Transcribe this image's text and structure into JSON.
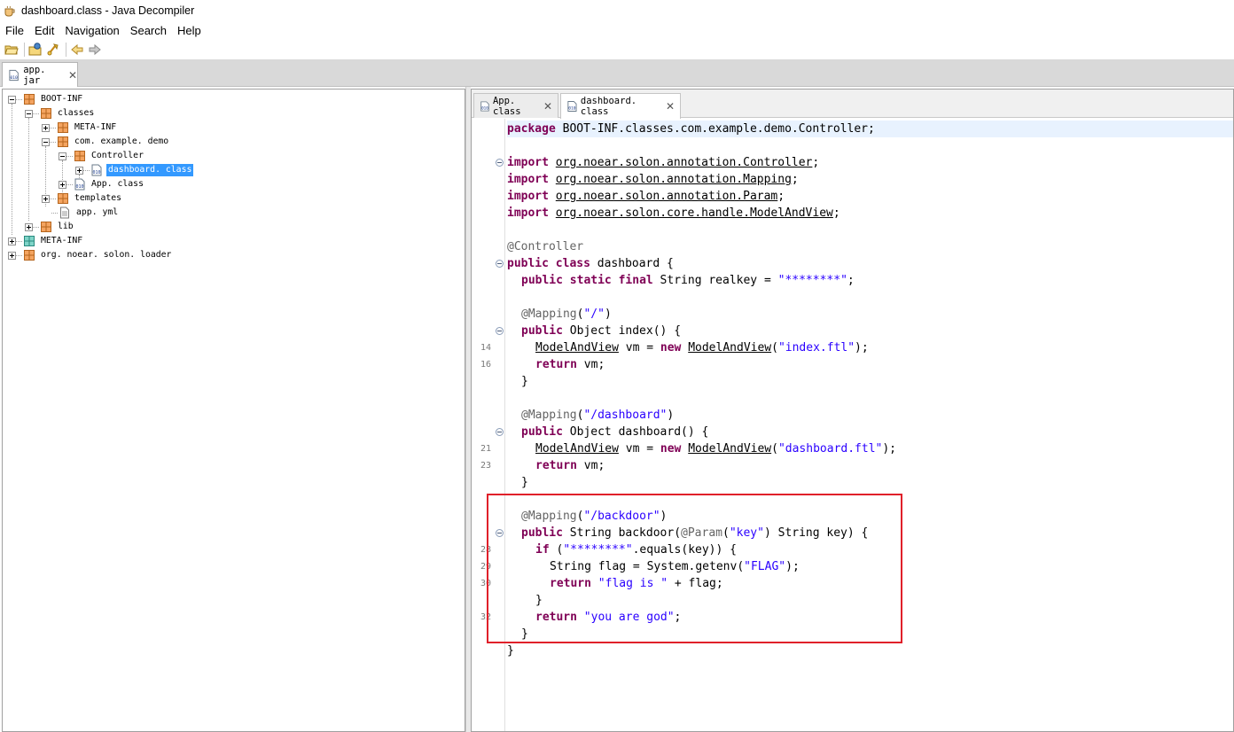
{
  "window": {
    "title": "dashboard.class - Java Decompiler"
  },
  "menu": [
    "File",
    "Edit",
    "Navigation",
    "Search",
    "Help"
  ],
  "toolbar": [
    "open-icon",
    "open-type-icon",
    "search-type-icon",
    "back-icon",
    "forward-icon"
  ],
  "jar_tab": {
    "label": "app. jar"
  },
  "tree": {
    "boot_inf": "BOOT-INF",
    "classes": "classes",
    "meta_inf_inner": "META-INF",
    "com_example_demo": "com. example. demo",
    "controller": "Controller",
    "dashboard_class": "dashboard. class",
    "app_class": "App. class",
    "templates": "templates",
    "app_yml": "app. yml",
    "lib": "lib",
    "meta_inf": "META-INF",
    "solon_loader": "org. noear. solon. loader"
  },
  "editor_tabs": [
    {
      "label": "App. class"
    },
    {
      "label": "dashboard. class"
    }
  ],
  "line_numbers": {
    "n14": "14",
    "n16": "16",
    "n21": "21",
    "n23": "23",
    "n28": "28",
    "n29": "29",
    "n30": "30",
    "n32": "32"
  },
  "code": {
    "package_kw": "package",
    "package_name": " BOOT-INF.classes.com.example.demo.Controller;",
    "import_kw": "import",
    "import1": "org.noear.solon.annotation.Controller",
    "import2": "org.noear.solon.annotation.Mapping",
    "import3": "org.noear.solon.annotation.Param",
    "import4": "org.noear.solon.core.handle.ModelAndView",
    "semi": ";",
    "ann_controller": "@Controller",
    "kw_public": "public",
    "kw_class": "class",
    "kw_static": "static",
    "kw_final": "final",
    "kw_new": "new",
    "kw_return": "return",
    "kw_if": "if",
    "class_decl": " dashboard {",
    "realkey_decl": " String realkey = ",
    "masked": "\"********\"",
    "ann_mapping": "@Mapping",
    "ann_param": "@Param",
    "path_root": "\"/\"",
    "path_dashboard": "\"/dashboard\"",
    "path_backdoor": "\"/backdoor\"",
    "index_sig": " Object index() {",
    "dashboard_sig": " Object dashboard() {",
    "backdoor_sig_pre": " String backdoor(",
    "param_key": "\"key\"",
    "backdoor_sig_post": ") String key) {",
    "model_and_view": "ModelAndView",
    "vm_assign": " vm = ",
    "index_ftl": "\"index.ftl\"",
    "dashboard_ftl": "\"dashboard.ftl\"",
    "return_vm": " vm;",
    "equals_call": ".equals(key)) {",
    "flag_decl_pre": "String flag = System.getenv(",
    "flag_env": "\"FLAG\"",
    "flag_decl_post": ");",
    "flag_is": "\"flag is \"",
    "plus_flag": " + flag;",
    "you_are_god": "\"you are god\"",
    "open_brace": "{",
    "close_brace": "}",
    "open_paren": "(",
    "close_paren": ")",
    "close_paren_semi": ");",
    "if_open": " (",
    "space": " "
  }
}
